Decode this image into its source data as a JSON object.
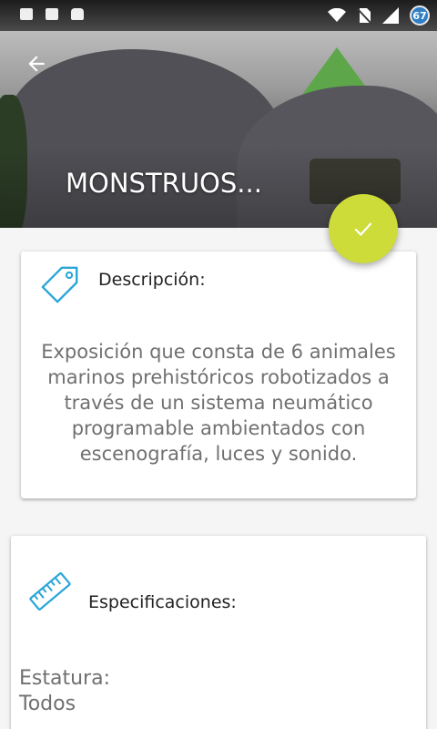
{
  "status_bar": {
    "battery_level": "67",
    "icons": [
      "notification-icon",
      "image-icon",
      "android-icon",
      "wifi-icon",
      "no-sim-icon",
      "signal-icon"
    ]
  },
  "header": {
    "title": "MONSTRUOS...",
    "back_icon": "arrow-left-icon"
  },
  "fab": {
    "icon": "check-icon",
    "color": "#cddc39"
  },
  "description_card": {
    "heading": "Descripción:",
    "icon": "tag-icon",
    "body": "Exposición que consta de 6 animales marinos prehistóricos robotizados a través de un sistema neumático programable ambientados con escenografía, luces y sonido."
  },
  "specs_card": {
    "heading": "Especificaciones:",
    "icon": "ruler-icon",
    "label": "Estatura:",
    "value": "Todos"
  },
  "colors": {
    "accent": "#cddc39",
    "icon_blue": "#2ba6d9",
    "text_secondary": "#707070"
  }
}
